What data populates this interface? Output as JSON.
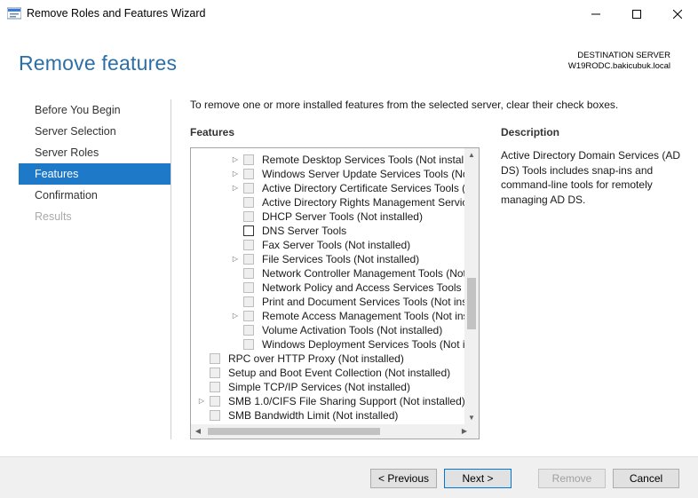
{
  "window": {
    "title": "Remove Roles and Features Wizard"
  },
  "header": {
    "page_title": "Remove features",
    "destination_label": "DESTINATION SERVER",
    "destination_server": "W19RODC.bakicubuk.local"
  },
  "nav": {
    "items": [
      {
        "label": "Before You Begin",
        "state": "normal"
      },
      {
        "label": "Server Selection",
        "state": "normal"
      },
      {
        "label": "Server Roles",
        "state": "normal"
      },
      {
        "label": "Features",
        "state": "active"
      },
      {
        "label": "Confirmation",
        "state": "normal"
      },
      {
        "label": "Results",
        "state": "disabled"
      }
    ]
  },
  "main": {
    "instruction": "To remove one or more installed features from the selected server, clear their check boxes.",
    "features_heading": "Features",
    "description_heading": "Description",
    "description_text": "Active Directory Domain Services (AD DS) Tools includes snap-ins and command-line tools for remotely managing AD DS."
  },
  "features": [
    {
      "label": "Remote Desktop Services Tools (Not installed)",
      "expandable": true,
      "level": 2,
      "enabled": false
    },
    {
      "label": "Windows Server Update Services Tools (Not installed)",
      "expandable": true,
      "level": 2,
      "enabled": false
    },
    {
      "label": "Active Directory Certificate Services Tools (Not installed)",
      "expandable": true,
      "level": 2,
      "enabled": false
    },
    {
      "label": "Active Directory Rights Management Services Tools",
      "expandable": false,
      "level": 2,
      "enabled": false
    },
    {
      "label": "DHCP Server Tools (Not installed)",
      "expandable": false,
      "level": 2,
      "enabled": false
    },
    {
      "label": "DNS Server Tools",
      "expandable": false,
      "level": 2,
      "enabled": true
    },
    {
      "label": "Fax Server Tools (Not installed)",
      "expandable": false,
      "level": 2,
      "enabled": false
    },
    {
      "label": "File Services Tools (Not installed)",
      "expandable": true,
      "level": 2,
      "enabled": false
    },
    {
      "label": "Network Controller Management Tools (Not installed)",
      "expandable": false,
      "level": 2,
      "enabled": false
    },
    {
      "label": "Network Policy and Access Services Tools (Not installed)",
      "expandable": false,
      "level": 2,
      "enabled": false
    },
    {
      "label": "Print and Document Services Tools (Not installed)",
      "expandable": false,
      "level": 2,
      "enabled": false
    },
    {
      "label": "Remote Access Management Tools (Not installed)",
      "expandable": true,
      "level": 2,
      "enabled": false
    },
    {
      "label": "Volume Activation Tools (Not installed)",
      "expandable": false,
      "level": 2,
      "enabled": false
    },
    {
      "label": "Windows Deployment Services Tools (Not installed)",
      "expandable": false,
      "level": 2,
      "enabled": false
    },
    {
      "label": "RPC over HTTP Proxy (Not installed)",
      "expandable": false,
      "level": 0,
      "enabled": false
    },
    {
      "label": "Setup and Boot Event Collection (Not installed)",
      "expandable": false,
      "level": 0,
      "enabled": false
    },
    {
      "label": "Simple TCP/IP Services (Not installed)",
      "expandable": false,
      "level": 0,
      "enabled": false
    },
    {
      "label": "SMB 1.0/CIFS File Sharing Support (Not installed)",
      "expandable": true,
      "level": 0,
      "enabled": false
    },
    {
      "label": "SMB Bandwidth Limit (Not installed)",
      "expandable": false,
      "level": 0,
      "enabled": false
    }
  ],
  "footer": {
    "previous_label": "< Previous",
    "next_label": "Next >",
    "remove_label": "Remove",
    "cancel_label": "Cancel"
  },
  "colors": {
    "accent": "#1e79c9",
    "title_blue": "#2c6fa8"
  }
}
